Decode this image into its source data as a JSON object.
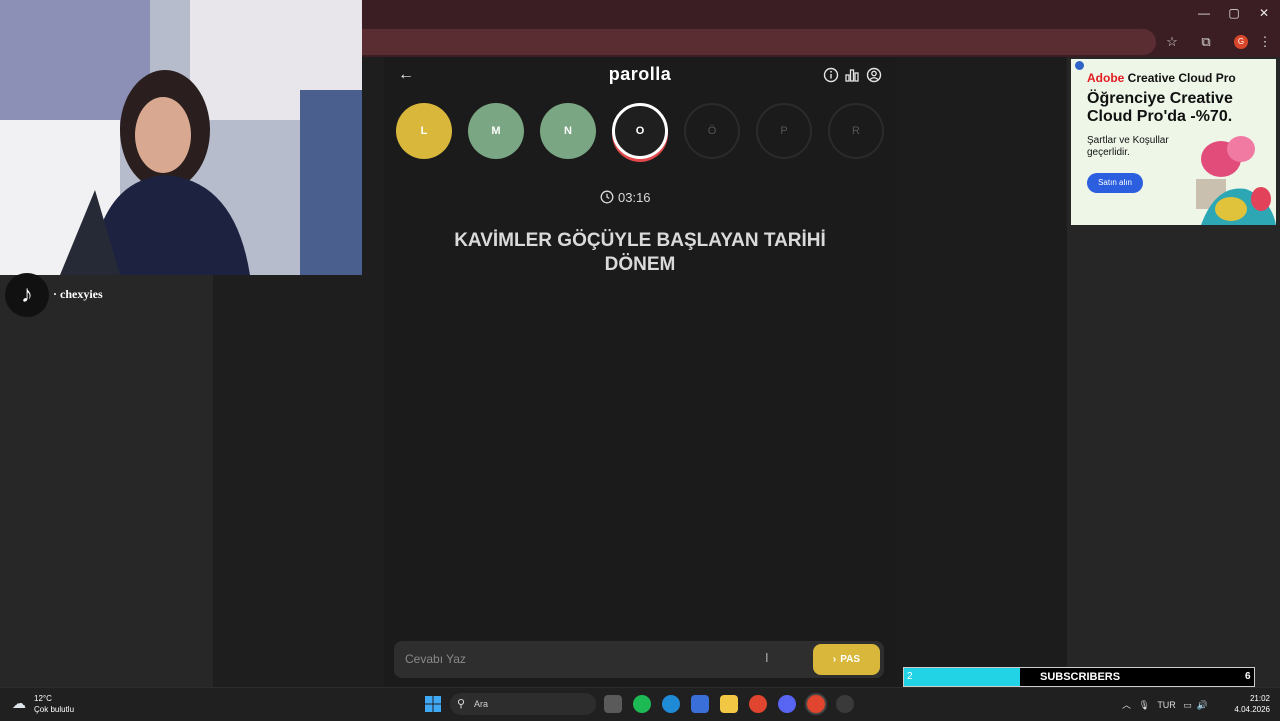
{
  "browser": {
    "window_controls": {
      "minimize": "—",
      "maximize": "▢",
      "close": "✕"
    },
    "profile_initial": "G"
  },
  "game": {
    "title": "parolla",
    "letters": [
      {
        "char": "L",
        "state": "correct-yellow"
      },
      {
        "char": "M",
        "state": "correct-green"
      },
      {
        "char": "N",
        "state": "correct-green"
      },
      {
        "char": "O",
        "state": "current"
      },
      {
        "char": "Ö",
        "state": "empty"
      },
      {
        "char": "P",
        "state": "empty"
      },
      {
        "char": "R",
        "state": "empty"
      }
    ],
    "timer": "03:16",
    "question": "KAVİMLER GÖÇÜYLE BAŞLAYAN TARİHİ DÖNEM",
    "answer_placeholder": "Cevabı Yaz",
    "pass_label": "PAS",
    "colors": {
      "yellow": "#d8b73b",
      "green": "#7aa683",
      "current_ring": "#e0484b"
    }
  },
  "ad": {
    "brand_prefix": "Adobe",
    "brand_rest": " Creative Cloud Pro",
    "headline": "Öğrenciye Creative Cloud Pro'da -%70.",
    "subtext": "Şartlar ve Koşullar geçerlidir.",
    "button": "Satın alın"
  },
  "overlay": {
    "tiktok_handle": "· chexyies",
    "subscribers_current": "2",
    "subscribers_label": "SUBSCRIBERS",
    "subscribers_goal": "6",
    "subscribers_progress": 0.33
  },
  "taskbar": {
    "weather_temp": "12°C",
    "weather_desc": "Çok bulutlu",
    "search_label": "Ara",
    "language": "TUR",
    "time": "21:02",
    "date": "4.04.2026"
  }
}
